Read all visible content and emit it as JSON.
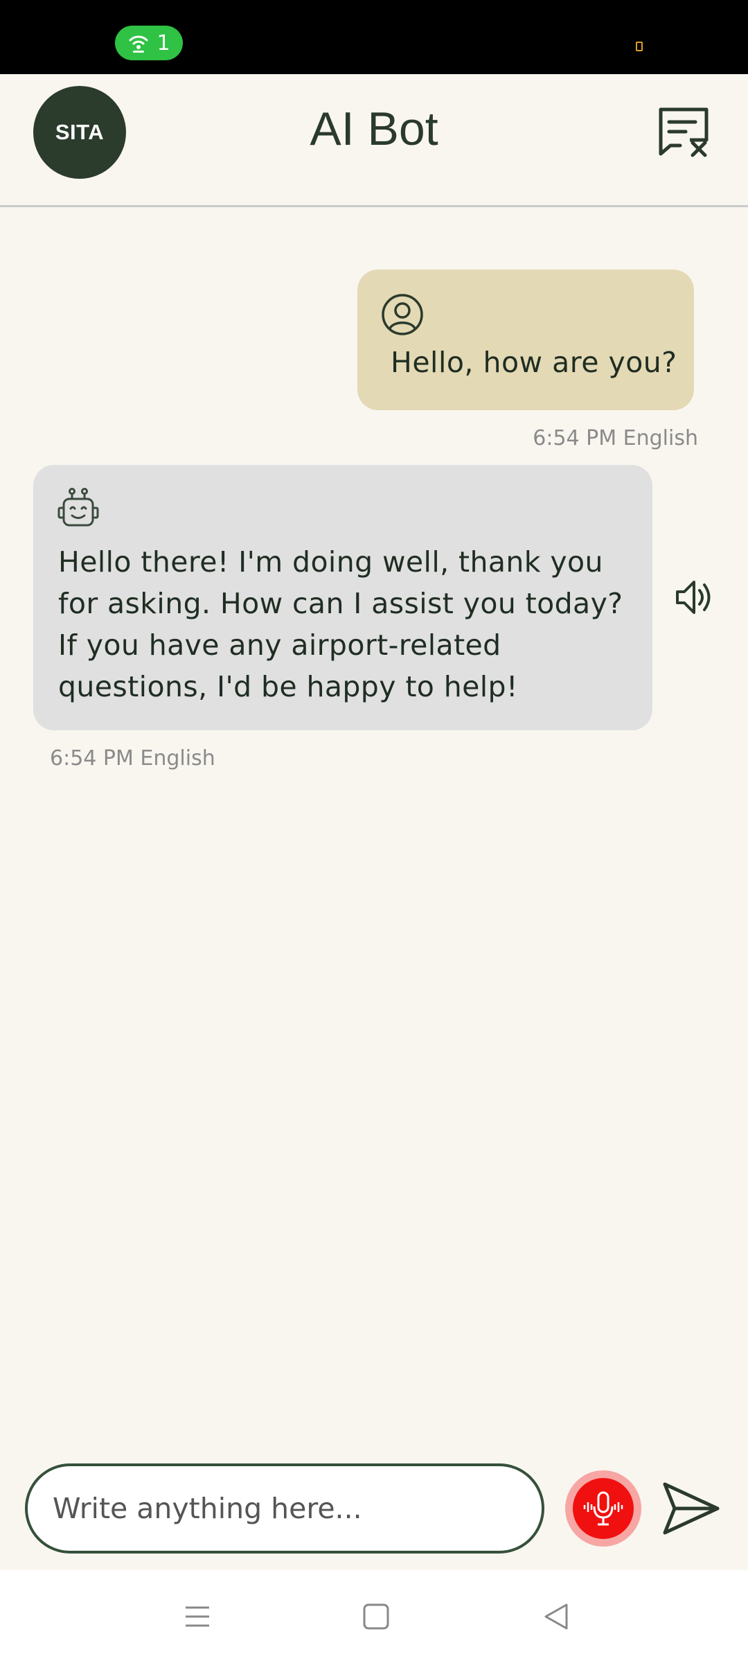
{
  "status_bar": {
    "hotspot_count": "1",
    "hotspot_color": "#2fc244"
  },
  "header": {
    "logo_text": "SITA",
    "title": "AI Bot",
    "clear_icon": "chat-clear-icon"
  },
  "messages": [
    {
      "sender": "user",
      "icon": "user-circle-icon",
      "text": "Hello, how are you?",
      "meta": "6:54 PM English",
      "bubble_color": "#e3d9b5"
    },
    {
      "sender": "bot",
      "icon": "robot-icon",
      "text": "Hello there! I'm doing well, thank you for asking. How can I assist you today? If you have any airport-related questions, I'd be happy to help!",
      "meta": "6:54 PM English",
      "bubble_color": "#e0e0e0",
      "action_icon": "speaker-icon"
    }
  ],
  "composer": {
    "placeholder": "Write anything here...",
    "value": "",
    "mic_icon": "microphone-icon",
    "mic_color": "#f01010",
    "send_icon": "send-icon"
  },
  "nav_bar": {
    "buttons": [
      "menu-icon",
      "home-icon",
      "back-icon"
    ]
  },
  "colors": {
    "background": "#f9f6f0",
    "brand_dark_green": "#2b3b2c"
  }
}
